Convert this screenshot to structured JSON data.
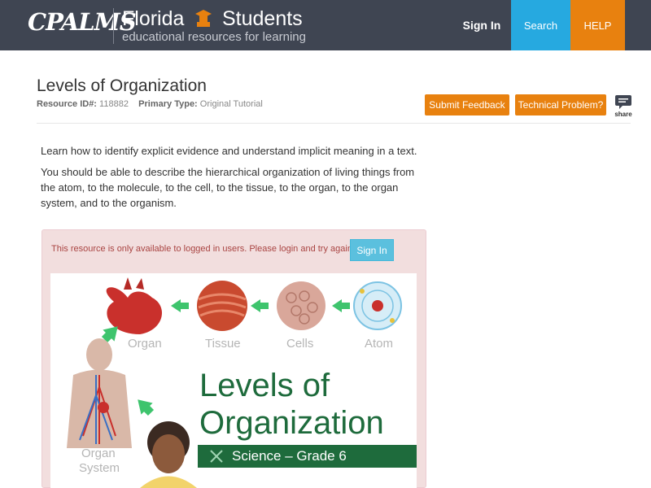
{
  "header": {
    "logo_text": "CPALMS",
    "site_name_part1": "Florida",
    "site_name_part2": "Students",
    "site_subtitle": "educational resources for learning",
    "nav": {
      "sign_in": "Sign In",
      "search": "Search",
      "help": "HELP"
    }
  },
  "resource": {
    "title": "Levels of Organization",
    "id_label": "Resource ID#:",
    "id_value": "118882",
    "type_label": "Primary Type:",
    "type_value": "Original Tutorial",
    "submit_feedback": "Submit Feedback",
    "technical_problem": "Technical Problem?",
    "share_label": "share"
  },
  "description": {
    "line1": "Learn how to identify explicit evidence and understand implicit meaning in a text.",
    "line2": "You should be able to describe the hierarchical organization of living things from the atom, to the molecule, to the cell, to the tissue, to the organ, to the organ system, and to the organism."
  },
  "alert": {
    "message": "This resource is only available to logged in users. Please login and try again.",
    "button": "Sign In"
  },
  "graphic": {
    "labels": {
      "organ": "Organ",
      "tissue": "Tissue",
      "cells": "Cells",
      "atom": "Atom",
      "organ_system_1": "Organ",
      "organ_system_2": "System"
    },
    "title_line1": "Levels of",
    "title_line2": "Organization",
    "banner": "Science – Grade 6"
  },
  "colors": {
    "header_bg": "#3f4552",
    "search_bg": "#26a9e0",
    "help_bg": "#e8810f",
    "orange_button": "#e8810f",
    "alert_bg": "#f2dede",
    "alert_text": "#a94442",
    "graphic_green": "#1e6b3c",
    "arrow_green": "#3ec46d"
  }
}
